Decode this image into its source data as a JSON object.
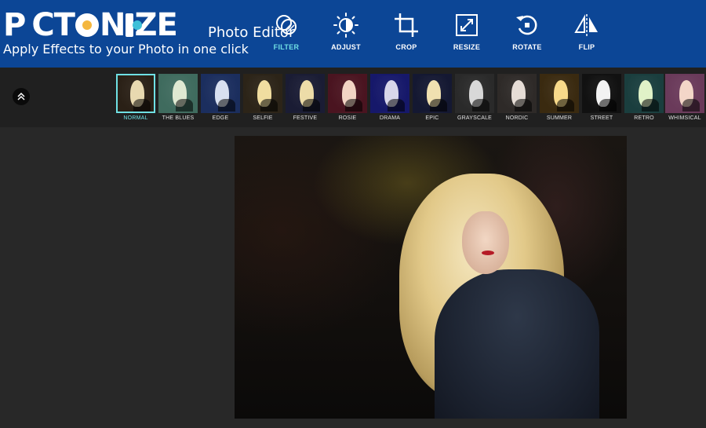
{
  "header": {
    "logo": {
      "part1": "PICT",
      "part2": "NIZE",
      "brand_colors": [
        "#f4b73e",
        "#3fc0d8"
      ]
    },
    "tagline": "Apply Effects to your Photo in one click",
    "app_title": "Photo Editor",
    "tools": [
      {
        "label": "FILTER",
        "icon": "filter-circles-icon",
        "active": true
      },
      {
        "label": "ADJUST",
        "icon": "brightness-icon",
        "active": false
      },
      {
        "label": "CROP",
        "icon": "crop-icon",
        "active": false
      },
      {
        "label": "RESIZE",
        "icon": "resize-icon",
        "active": false
      },
      {
        "label": "ROTATE",
        "icon": "rotate-icon",
        "active": false
      },
      {
        "label": "FLIP",
        "icon": "flip-icon",
        "active": false
      }
    ]
  },
  "filter_strip": {
    "collapse_icon": "chevron-up-icon",
    "filters": [
      {
        "label": "NORMAL",
        "active": true,
        "tint": "#2a2016"
      },
      {
        "label": "THE BLUES",
        "active": false,
        "tint": "#3f6b5e"
      },
      {
        "label": "EDGE",
        "active": false,
        "tint": "#1b2e5e"
      },
      {
        "label": "SELFIE",
        "active": false,
        "tint": "#2c2418"
      },
      {
        "label": "FESTIVE",
        "active": false,
        "tint": "#1a1c34"
      },
      {
        "label": "ROSIE",
        "active": false,
        "tint": "#4a1420"
      },
      {
        "label": "DRAMA",
        "active": false,
        "tint": "#16186a"
      },
      {
        "label": "EPIC",
        "active": false,
        "tint": "#141832"
      },
      {
        "label": "GRAYSCALE",
        "active": false,
        "tint": "#2a2a2a"
      },
      {
        "label": "NORDIC",
        "active": false,
        "tint": "#2e2a28"
      },
      {
        "label": "SUMMER",
        "active": false,
        "tint": "#3a2a10"
      },
      {
        "label": "STREET",
        "active": false,
        "tint": "#111111"
      },
      {
        "label": "RETRO",
        "active": false,
        "tint": "#1a3e3e"
      },
      {
        "label": "WHIMSICAL",
        "active": false,
        "tint": "#6a3a5a"
      }
    ]
  },
  "colors": {
    "header_bg": "#0c4696",
    "accent": "#6fe0e4",
    "workspace_bg": "#282828",
    "strip_bg": "#202020"
  }
}
